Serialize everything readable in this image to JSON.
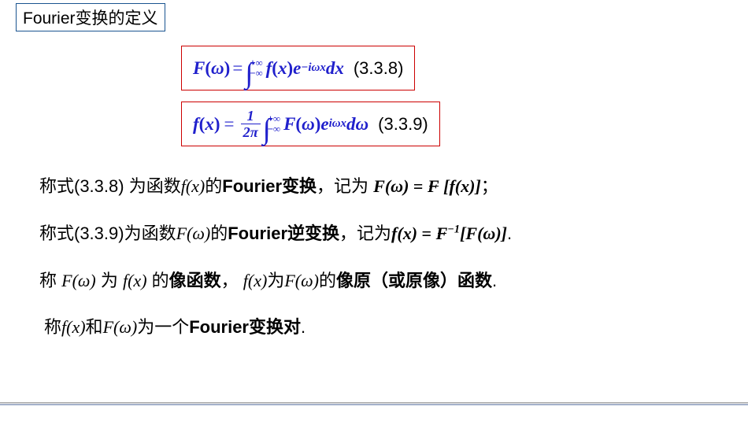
{
  "title": "Fourier变换的定义",
  "eq1_num": "(3.3.8)",
  "eq2_num": "(3.3.9)",
  "line1": {
    "t1": "称式(3.3.8) 为函数",
    "t2": "的",
    "t3": "Fourier变换",
    "t4": "，记为 ",
    "t5": "；"
  },
  "line2": {
    "t1": "称式(3.3.9)为函数",
    "t2": "的",
    "t3": "Fourier逆变换",
    "t4": "，记为",
    "t5": "."
  },
  "line3": {
    "t1": "称 ",
    "t2": " 为 ",
    "t3": " 的",
    "t4": "像函数",
    "t5": "， ",
    "t6": "为",
    "t7": "的",
    "t8": "像原（或原像）函数",
    "t9": "."
  },
  "line4": {
    "t1": "称",
    "t2": "和",
    "t3": "为一个",
    "t4": "Fourier变换对",
    "t5": "."
  },
  "sym": {
    "fx": "f(x)",
    "Fw": "F(ω)",
    "Fw_b": "F(ω)",
    "fx_b": "f(x)",
    "eq": " = ",
    "minus1": "−1"
  }
}
